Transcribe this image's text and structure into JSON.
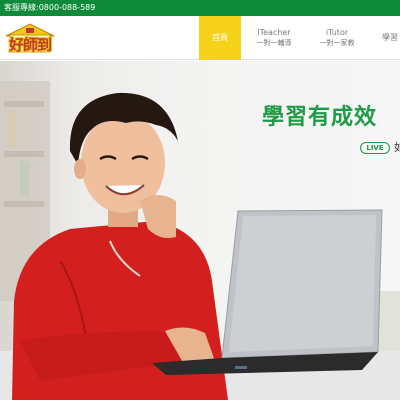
{
  "topbar": {
    "hotline": "客服專線:0800-088-589"
  },
  "brand": {
    "logo_text": "好師到",
    "logo_icon": "house-logo-icon"
  },
  "nav": {
    "items": [
      {
        "title": "首頁",
        "subtitle": ""
      },
      {
        "title": "iTeacher",
        "subtitle": "一對一輔導"
      },
      {
        "title": "iTutor",
        "subtitle": "一對一家教"
      },
      {
        "title": "學習",
        "subtitle": ""
      }
    ]
  },
  "hero": {
    "headline": "學習有成效",
    "badge": "LIVE",
    "badge_suffix": "如",
    "image": "student-with-laptop"
  },
  "colors": {
    "accent_green": "#1f9a46",
    "topbar_green": "#0e8a3a",
    "nav_active_yellow": "#f6d21a"
  }
}
